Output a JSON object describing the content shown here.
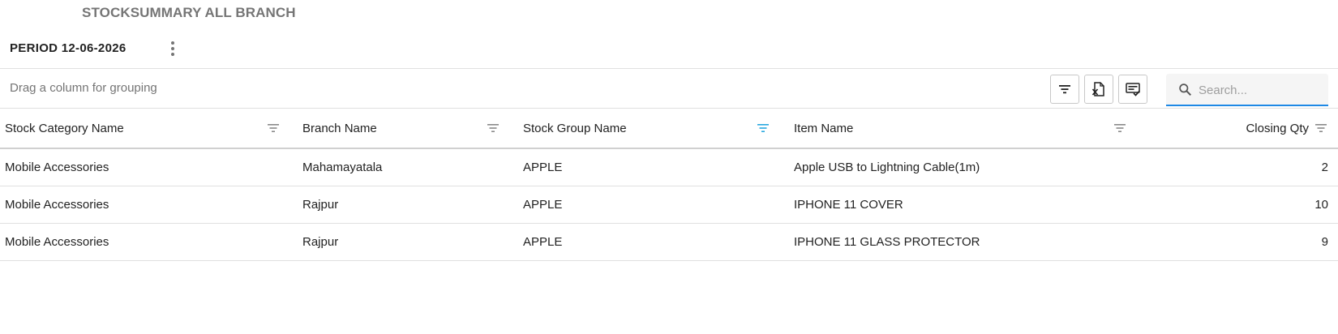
{
  "page": {
    "title": "STOCKSUMMARY ALL BRANCH",
    "period_label": "PERIOD 12-06-2026"
  },
  "toolbar": {
    "group_hint": "Drag a column for grouping",
    "search_placeholder": "Search...",
    "buttons": [
      "filter-icon",
      "export-excel-icon",
      "column-chooser-icon"
    ]
  },
  "grid": {
    "columns": [
      {
        "label": "Stock Category Name",
        "filter_active": false
      },
      {
        "label": "Branch Name",
        "filter_active": false
      },
      {
        "label": "Stock Group Name",
        "filter_active": true
      },
      {
        "label": "Item Name",
        "filter_active": false
      },
      {
        "label": "Closing Qty",
        "filter_active": false
      }
    ],
    "rows": [
      {
        "category": "Mobile Accessories",
        "branch": "Mahamayatala",
        "group": "APPLE",
        "item": "Apple USB to Lightning Cable(1m)",
        "qty": "2"
      },
      {
        "category": "Mobile Accessories",
        "branch": "Rajpur",
        "group": "APPLE",
        "item": "IPHONE 11 COVER",
        "qty": "10"
      },
      {
        "category": "Mobile Accessories",
        "branch": "Rajpur",
        "group": "APPLE",
        "item": "IPHONE 11 GLASS PROTECTOR",
        "qty": "9"
      }
    ]
  },
  "colors": {
    "accent": "#1e88e5",
    "filter_active": "#29a8e0",
    "filter_inactive": "#8a8a8a",
    "title_gray": "#757575"
  }
}
